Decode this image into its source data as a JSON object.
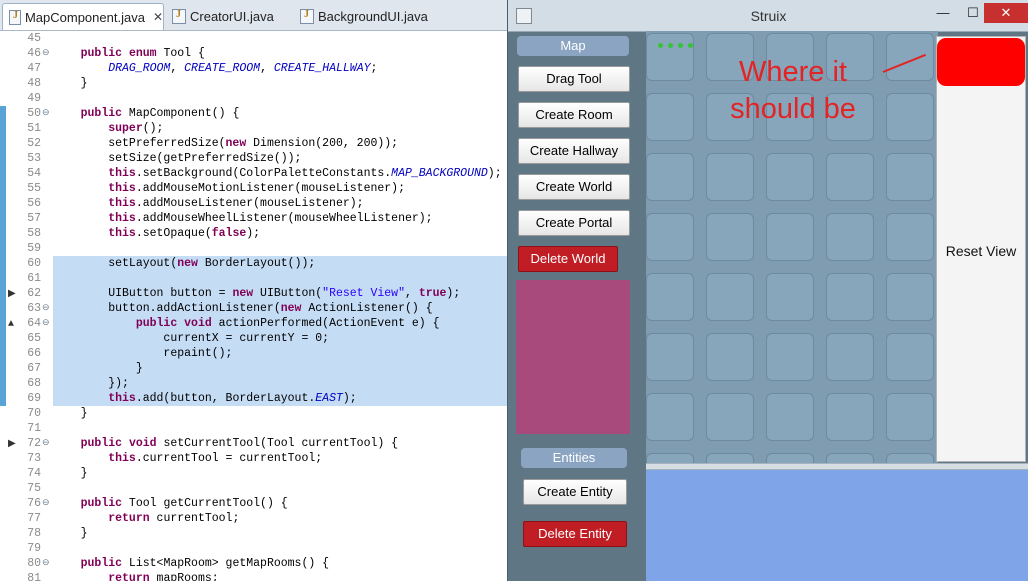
{
  "editor": {
    "tabs": [
      {
        "label": "MapComponent.java",
        "active": true
      },
      {
        "label": "CreatorUI.java",
        "active": false
      },
      {
        "label": "BackgroundUI.java",
        "active": false
      }
    ],
    "lines": [
      {
        "num": "45",
        "text": ""
      },
      {
        "num": "46",
        "text": "    public enum Tool {",
        "fold": true
      },
      {
        "num": "47",
        "text": "        DRAG_ROOM, CREATE_ROOM, CREATE_HALLWAY;"
      },
      {
        "num": "48",
        "text": "    }"
      },
      {
        "num": "49",
        "text": ""
      },
      {
        "num": "50",
        "text": "    public MapComponent() {",
        "fold": true,
        "changed": true
      },
      {
        "num": "51",
        "text": "        super();",
        "changed": true
      },
      {
        "num": "52",
        "text": "        setPreferredSize(new Dimension(200, 200));",
        "changed": true
      },
      {
        "num": "53",
        "text": "        setSize(getPreferredSize());",
        "changed": true
      },
      {
        "num": "54",
        "text": "        this.setBackground(ColorPaletteConstants.MAP_BACKGROUND);",
        "changed": true
      },
      {
        "num": "55",
        "text": "        this.addMouseMotionListener(mouseListener);",
        "changed": true
      },
      {
        "num": "56",
        "text": "        this.addMouseListener(mouseListener);",
        "changed": true
      },
      {
        "num": "57",
        "text": "        this.addMouseWheelListener(mouseWheelListener);",
        "changed": true
      },
      {
        "num": "58",
        "text": "        this.setOpaque(false);",
        "changed": true
      },
      {
        "num": "59",
        "text": "",
        "changed": true
      },
      {
        "num": "60",
        "text": "        setLayout(new BorderLayout());",
        "changed": true,
        "selected": true
      },
      {
        "num": "61",
        "text": "",
        "changed": true,
        "selected": true
      },
      {
        "num": "62",
        "text": "        UIButton button = new UIButton(\"Reset View\", true);",
        "changed": true,
        "selected": true,
        "marker": "▶"
      },
      {
        "num": "63",
        "text": "        button.addActionListener(new ActionListener() {",
        "changed": true,
        "selected": true,
        "fold": true
      },
      {
        "num": "64",
        "text": "            public void actionPerformed(ActionEvent e) {",
        "changed": true,
        "selected": true,
        "fold": true,
        "marker": "▲"
      },
      {
        "num": "65",
        "text": "                currentX = currentY = 0;",
        "changed": true,
        "selected": true
      },
      {
        "num": "66",
        "text": "                repaint();",
        "changed": true,
        "selected": true
      },
      {
        "num": "67",
        "text": "            }",
        "changed": true,
        "selected": true
      },
      {
        "num": "68",
        "text": "        });",
        "changed": true,
        "selected": true
      },
      {
        "num": "69",
        "text": "        this.add(button, BorderLayout.EAST);",
        "changed": true,
        "selected": true
      },
      {
        "num": "70",
        "text": "    }"
      },
      {
        "num": "71",
        "text": ""
      },
      {
        "num": "72",
        "text": "    public void setCurrentTool(Tool currentTool) {",
        "fold": true,
        "marker": "▶"
      },
      {
        "num": "73",
        "text": "        this.currentTool = currentTool;"
      },
      {
        "num": "74",
        "text": "    }"
      },
      {
        "num": "75",
        "text": ""
      },
      {
        "num": "76",
        "text": "    public Tool getCurrentTool() {",
        "fold": true
      },
      {
        "num": "77",
        "text": "        return currentTool;"
      },
      {
        "num": "78",
        "text": "    }"
      },
      {
        "num": "79",
        "text": ""
      },
      {
        "num": "80",
        "text": "    public List<MapRoom> getMapRooms() {",
        "fold": true
      },
      {
        "num": "81",
        "text": "        return mapRooms;"
      }
    ]
  },
  "app": {
    "title": "Struix",
    "controls": {
      "minimize": "—",
      "maximize": "☐",
      "close": "✕"
    },
    "map_header": "Map",
    "map_buttons": [
      "Drag Tool",
      "Create Room",
      "Create Hallway",
      "Create World",
      "Create Portal"
    ],
    "delete_world": "Delete World",
    "entities_header": "Entities",
    "create_entity": "Create Entity",
    "delete_entity": "Delete Entity",
    "reset_view": "Reset View",
    "annotation": "Where it should be",
    "colors": {
      "map_bg": "#7f9cb1",
      "annotation": "#e22424",
      "red_button": "#c11d24",
      "entity_area": "#a84a7c",
      "bottom_panel": "#7fa5e8"
    }
  }
}
